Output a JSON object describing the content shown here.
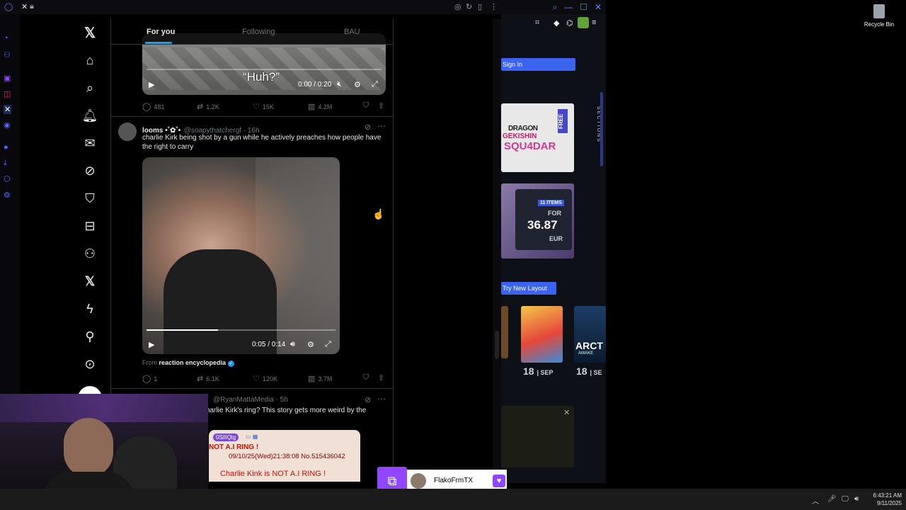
{
  "browser": {
    "tab_icon": "x-logo-icon"
  },
  "x": {
    "tabs": [
      {
        "label": "For you"
      },
      {
        "label": "Following"
      },
      {
        "label": "BAU"
      }
    ],
    "post1": {
      "caption": "“Huh?”",
      "time": "0:00 / 0:20",
      "replies": "481",
      "reposts": "1.2K",
      "likes": "15K",
      "views": "4.2M"
    },
    "post2": {
      "name": "looms •˚✿˚•",
      "handle": "@soapythatchergf · 16h",
      "text": "charlie Kirk being shot by a gun while he actively preaches how people have the right to carry",
      "time": "0:05 / 0:14",
      "progress": 0.38,
      "from_label": "From",
      "from_source": "reaction encyclopedia",
      "replies": "1",
      "reposts": "6.1K",
      "likes": "120K",
      "views": "3.7M"
    },
    "post3": {
      "handle": "@RyanMattaMedia · 5h",
      "text": "harlie Kirk's ring? This story gets more weird by the",
      "img_tag": "0SilIQlg",
      "img_title": "NOT A.I RING !",
      "img_meta": "09/10/25(Wed)21:38:08 No.515436042",
      "img_body": "Charlie Kink is NOT A.I RING !"
    }
  },
  "right_panel": {
    "sign_in": "Sign In",
    "free_badge": "FREE",
    "game_title_line1": "DRAGON",
    "game_title_line2": "GEKISHIN",
    "game_title_line3": "SQU4DAR",
    "sections_label": "SECTIONS",
    "items_badge": "11 ITEMS",
    "for_label": "FOR",
    "price": "36.87",
    "currency": "EUR",
    "try_layout": "Try New Layout",
    "date1_day": "18",
    "date1_month": "| SEP",
    "date2_day": "18",
    "date2_month": "| SE",
    "game2_title": "ARCT",
    "game2_sub": "AWAKE"
  },
  "twitch_alert": {
    "username": "FlakoFrmTX"
  },
  "desktop": {
    "recycle_bin": "Recycle Bin"
  },
  "taskbar": {
    "time": "6:43:21 AM",
    "date": "9/11/2025"
  }
}
